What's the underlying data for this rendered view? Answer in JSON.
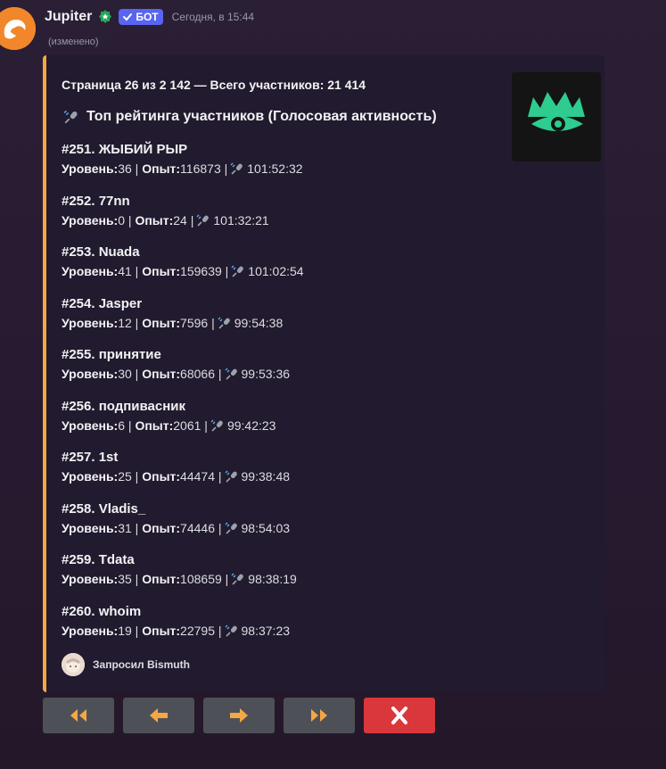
{
  "message": {
    "username": "Jupiter",
    "bot_tag": "БОТ",
    "timestamp": "Сегодня, в 15:44",
    "edited": "(изменено)"
  },
  "embed": {
    "accent_color": "#f5a742",
    "author": "Страница 26 из 2 142 — Всего участников: 21 414",
    "title": "Топ рейтинга участников (Голосовая активность)",
    "level_label": "Уровень:",
    "xp_label": "Опыт:",
    "entries": [
      {
        "name": "#251. ЖЫБИЙ РЫР",
        "level": "36",
        "xp": "116873",
        "time": "101:52:32"
      },
      {
        "name": "#252. 77nn",
        "level": "0",
        "xp": "24",
        "time": "101:32:21"
      },
      {
        "name": "#253. Nuada",
        "level": "41",
        "xp": "159639",
        "time": "101:02:54"
      },
      {
        "name": "#254. Jasper",
        "level": "12",
        "xp": "7596",
        "time": "99:54:38"
      },
      {
        "name": "#255. принятие",
        "level": "30",
        "xp": "68066",
        "time": "99:53:36"
      },
      {
        "name": "#256. подпивасник",
        "level": "6",
        "xp": "2061",
        "time": "99:42:23"
      },
      {
        "name": "#257. 1st",
        "level": "25",
        "xp": "44474",
        "time": "99:38:48"
      },
      {
        "name": "#258. Vladis_",
        "level": "31",
        "xp": "74446",
        "time": "98:54:03"
      },
      {
        "name": "#259. Tdata",
        "level": "35",
        "xp": "108659",
        "time": "98:38:19"
      },
      {
        "name": "#260. whoim",
        "level": "19",
        "xp": "22795",
        "time": "98:37:23"
      }
    ],
    "footer": "Запросил Bismuth"
  },
  "buttons": [
    {
      "name": "first-page-button",
      "icon": "double-arrow-left-icon"
    },
    {
      "name": "prev-page-button",
      "icon": "arrow-left-icon"
    },
    {
      "name": "next-page-button",
      "icon": "arrow-right-icon"
    },
    {
      "name": "last-page-button",
      "icon": "double-arrow-right-icon"
    },
    {
      "name": "close-button",
      "icon": "close-x-icon"
    }
  ],
  "colors": {
    "bot_tag": "#5865f2",
    "button": "#4e5058",
    "danger": "#da373c",
    "arrow": "#f5a742"
  }
}
